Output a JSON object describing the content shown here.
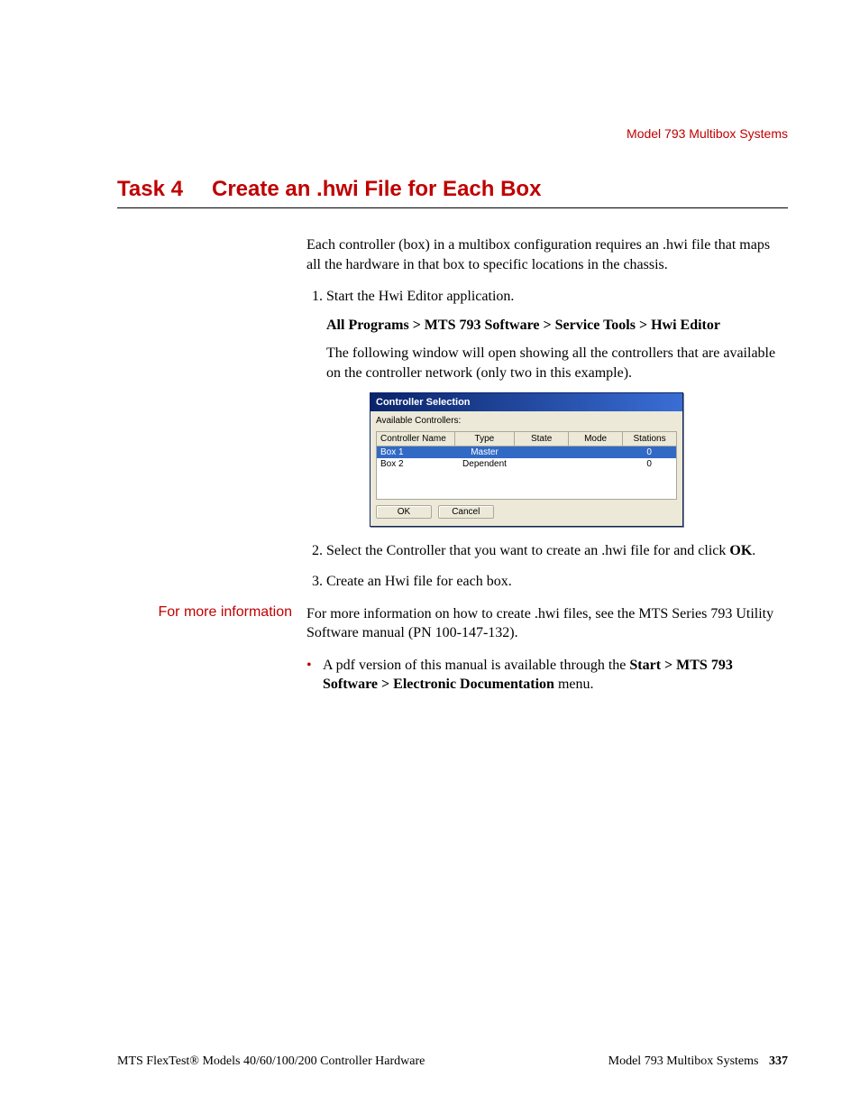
{
  "header": {
    "section": "Model 793 Multibox Systems"
  },
  "title": {
    "task_label": "Task 4",
    "heading": "Create an .hwi File for Each Box"
  },
  "intro": "Each controller (box) in a multibox configuration requires an .hwi file that maps all the hardware in that box to specific locations in the chassis.",
  "steps": {
    "s1": "Start the Hwi Editor application.",
    "s1_path": "All Programs > MTS 793 Software > Service Tools > Hwi Editor",
    "s1_after": "The following window will open showing all the controllers that are available on the controller network (only two in this example).",
    "s2_pre": "Select the Controller that you want to create an .hwi file for and click ",
    "s2_bold": "OK",
    "s2_post": ".",
    "s3": "Create an Hwi file for each box."
  },
  "dialog": {
    "title": "Controller Selection",
    "available": "Available Controllers:",
    "cols": {
      "c1": "Controller Name",
      "c2": "Type",
      "c3": "State",
      "c4": "Mode",
      "c5": "Stations"
    },
    "rows": [
      {
        "name": "Box 1",
        "type": "Master",
        "state": "",
        "mode": "",
        "stations": "0",
        "selected": true
      },
      {
        "name": "Box 2",
        "type": "Dependent",
        "state": "",
        "mode": "",
        "stations": "0",
        "selected": false
      }
    ],
    "ok": "OK",
    "cancel": "Cancel"
  },
  "info": {
    "label": "For more information",
    "p1": "For more information on how to create .hwi files, see the MTS Series 793 Utility Software manual (PN 100-147-132).",
    "b1_pre": "A pdf version of this manual is available through the ",
    "b1_bold": "Start > MTS 793 Software > Electronic Documentation",
    "b1_post": " menu."
  },
  "footer": {
    "left": "MTS FlexTest® Models 40/60/100/200 Controller Hardware",
    "right_label": "Model 793 Multibox Systems",
    "page": "337"
  }
}
